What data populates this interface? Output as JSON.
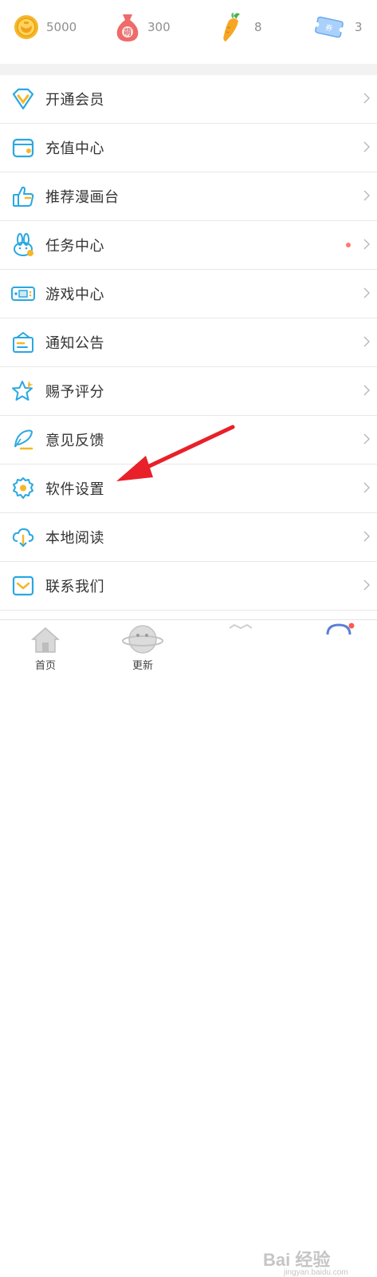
{
  "stats": [
    {
      "icon": "gold-coin-icon",
      "value": "5000",
      "color": "#f5b72a"
    },
    {
      "icon": "money-bag-icon",
      "value": "300",
      "color": "#f06a6a"
    },
    {
      "icon": "carrot-icon",
      "value": "8",
      "color": "#f6a623"
    },
    {
      "icon": "ticket-icon",
      "value": "3",
      "color": "#7fb6f2"
    }
  ],
  "money_bag_text": "萌",
  "ticket_text": "券",
  "menu": [
    {
      "label": "开通会员",
      "icon": "diamond-icon"
    },
    {
      "label": "充值中心",
      "icon": "wallet-icon"
    },
    {
      "label": "推荐漫画台",
      "icon": "thumbs-up-icon"
    },
    {
      "label": "任务中心",
      "icon": "rabbit-icon",
      "has_dot": true
    },
    {
      "label": "游戏中心",
      "icon": "gamepad-icon"
    },
    {
      "label": "通知公告",
      "icon": "notice-board-icon"
    },
    {
      "label": "赐予评分",
      "icon": "star-icon"
    },
    {
      "label": "意见反馈",
      "icon": "feather-pen-icon"
    },
    {
      "label": "软件设置",
      "icon": "gear-icon"
    },
    {
      "label": "本地阅读",
      "icon": "cloud-download-icon"
    },
    {
      "label": "联系我们",
      "icon": "mail-icon"
    }
  ],
  "tabs": [
    {
      "label": "首页",
      "icon": "home-icon"
    },
    {
      "label": "更新",
      "icon": "planet-icon"
    }
  ],
  "watermark": "Bai 经验",
  "watermark_url": "jingyan.baidu.com",
  "colors": {
    "accent": "#29a8e0",
    "arrow": "#e8202a",
    "divider": "#e8e8e8"
  }
}
